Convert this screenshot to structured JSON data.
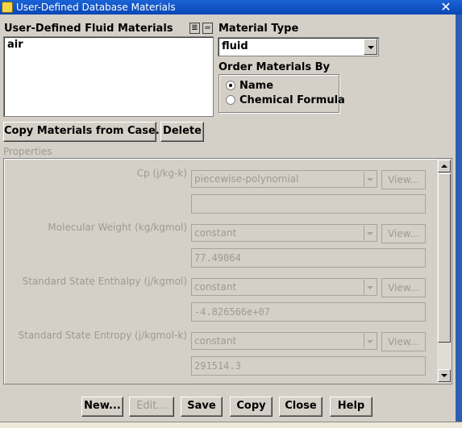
{
  "window": {
    "title": "User-Defined Database Materials",
    "close_glyph": "✕"
  },
  "fluid_materials": {
    "label": "User-Defined Fluid Materials",
    "items": [
      "air"
    ],
    "list_btn_glyph": "≣",
    "equal_btn_glyph": "="
  },
  "material_type": {
    "label": "Material Type",
    "value": "fluid"
  },
  "order": {
    "label": "Order Materials By",
    "options": [
      {
        "label": "Name",
        "selected": true
      },
      {
        "label": "Chemical Formula",
        "selected": false
      }
    ]
  },
  "actions": {
    "copy_from_case": "Copy Materials from Case...",
    "delete": "Delete"
  },
  "properties": {
    "label": "Properties",
    "view_label": "View...",
    "rows": [
      {
        "label": "Cp (j/kg-k)",
        "method": "piecewise-polynomial",
        "value": ""
      },
      {
        "label": "Molecular Weight (kg/kgmol)",
        "method": "constant",
        "value": "77.49064"
      },
      {
        "label": "Standard State Enthalpy (j/kgmol)",
        "method": "constant",
        "value": "-4.826566e+07"
      },
      {
        "label": "Standard State Entropy (j/kgmol-k)",
        "method": "constant",
        "value": "291514.3"
      }
    ]
  },
  "footer": {
    "new": "New...",
    "edit": "Edit...",
    "save": "Save",
    "copy": "Copy",
    "close": "Close",
    "help": "Help"
  }
}
